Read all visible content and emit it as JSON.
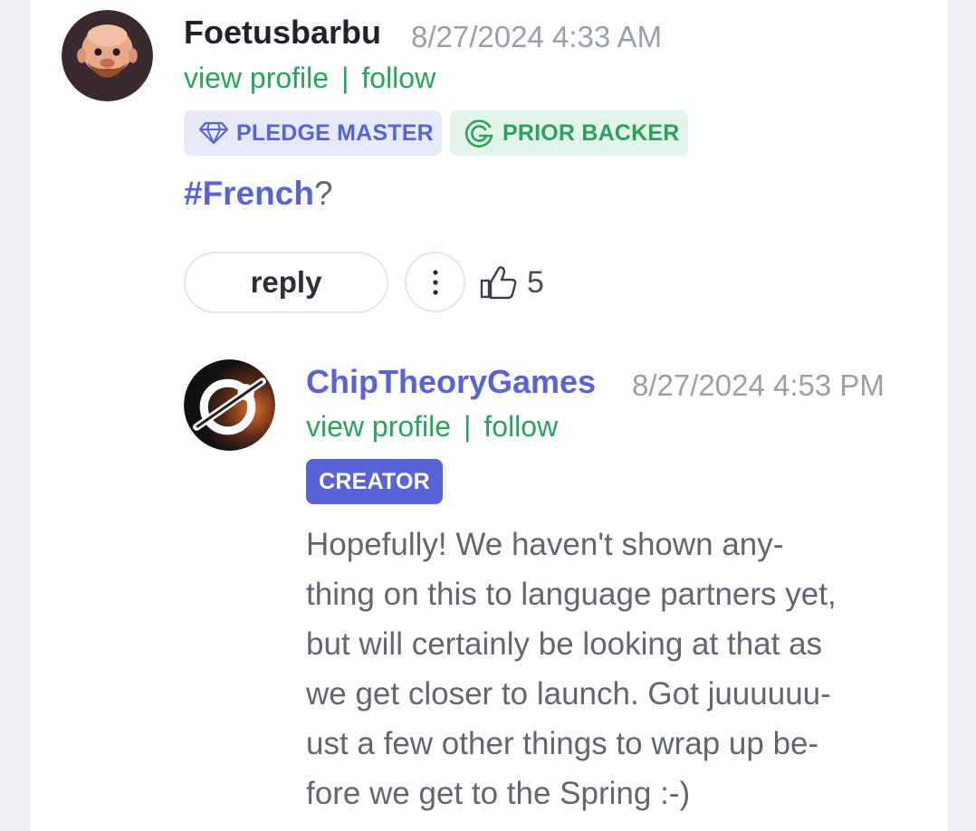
{
  "comment": {
    "author": "Foetusbarbu",
    "timestamp": "8/27/2024 4:33 AM",
    "view_profile": "view profile",
    "separator": "|",
    "follow": "follow",
    "badges": [
      {
        "label": "PLEDGE MASTER",
        "icon": "diamond-icon"
      },
      {
        "label": "PRIOR BACKER",
        "icon": "backer-g-icon"
      }
    ],
    "hashtag": "#French",
    "text_suffix": "?",
    "reply_label": "reply",
    "like_count": "5"
  },
  "reply": {
    "author": "ChipTheoryGames",
    "timestamp": "8/27/2024 4:53 PM",
    "view_profile": "view profile",
    "separator": "|",
    "follow": "follow",
    "badge": "CREATOR",
    "text_lines": [
      "Hopefully! We haven't shown any-",
      "thing on this to language partners yet,",
      "but will certainly be looking at that as",
      "we get closer to launch. Got juuuuuu-",
      "ust a few other things to wrap up be-",
      "fore we get to the Spring :-)"
    ]
  },
  "colors": {
    "link_green": "#2ba25b",
    "creator_blue": "#5a63d6",
    "author_dark": "#1f2229",
    "timestamp_gray": "#9aa0aa"
  }
}
